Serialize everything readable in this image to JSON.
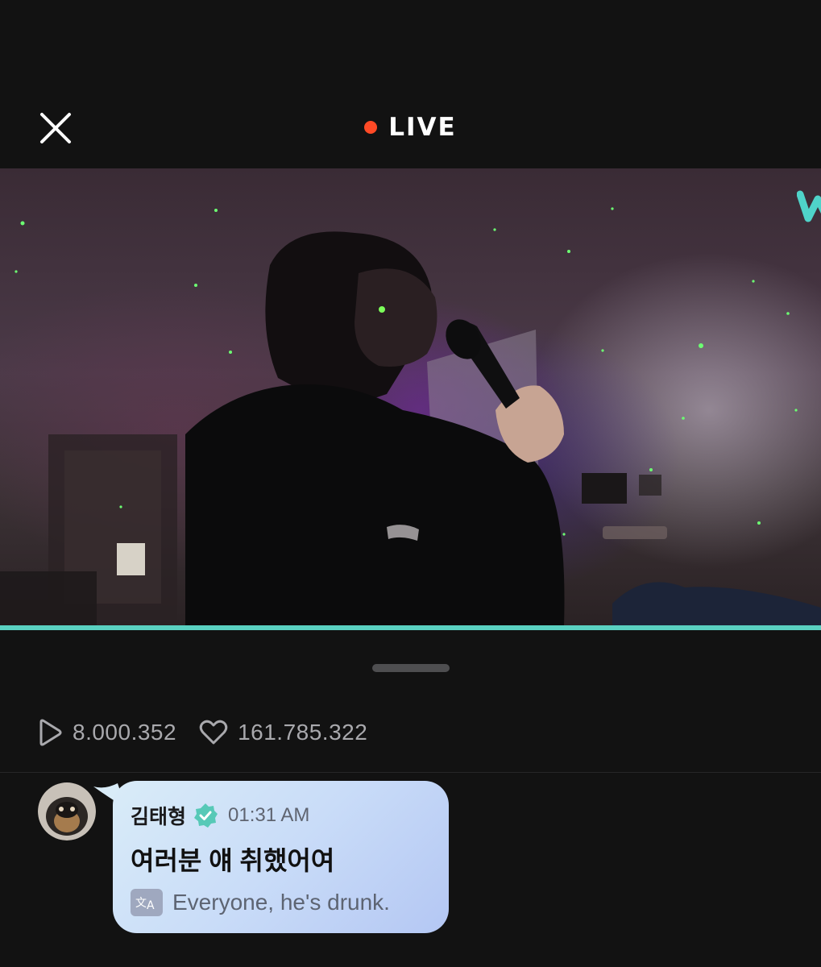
{
  "header": {
    "live_label": "LIVE",
    "live_dot_color": "#ff4a26",
    "close_icon": "close-icon"
  },
  "video": {
    "watermark_icon": "weverse-logo-icon",
    "progress": 1.0,
    "accent_color": "#5ad1c1"
  },
  "stats": {
    "plays": "8.000.352",
    "likes": "161.785.322"
  },
  "chat": {
    "message": {
      "author": "김태형",
      "verified": true,
      "time": "01:31 AM",
      "text": "여러분 얘 취했어여",
      "translation": "Everyone, he's drunk."
    }
  }
}
